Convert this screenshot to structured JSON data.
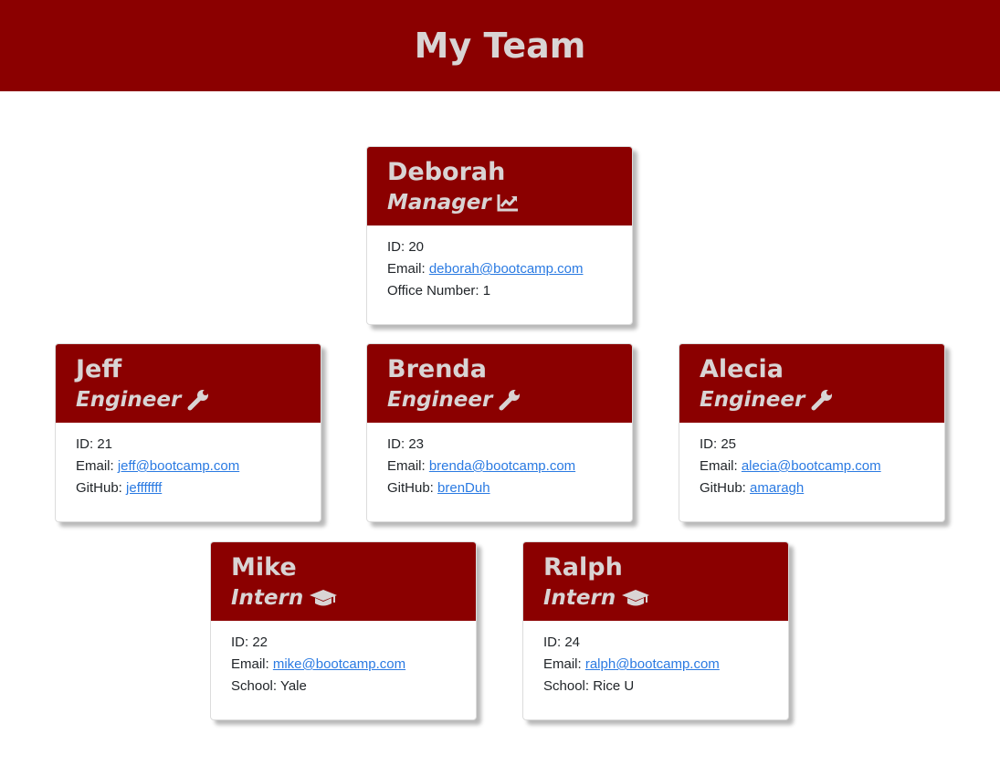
{
  "header": {
    "title": "My Team"
  },
  "labels": {
    "id": "ID: ",
    "email": "Email: ",
    "office": "Office Number: ",
    "github": "GitHub: ",
    "school": "School: "
  },
  "manager": {
    "name": "Deborah",
    "role": "Manager",
    "icon": "chart-line-icon",
    "id": "20",
    "email": "deborah@bootcamp.com",
    "office": "1"
  },
  "engineers": [
    {
      "name": "Jeff",
      "role": "Engineer",
      "icon": "wrench-icon",
      "id": "21",
      "email": "jeff@bootcamp.com",
      "github": "jefffffff"
    },
    {
      "name": "Brenda",
      "role": "Engineer",
      "icon": "wrench-icon",
      "id": "23",
      "email": "brenda@bootcamp.com",
      "github": "brenDuh"
    },
    {
      "name": "Alecia",
      "role": "Engineer",
      "icon": "wrench-icon",
      "id": "25",
      "email": "alecia@bootcamp.com",
      "github": "amaragh"
    }
  ],
  "interns": [
    {
      "name": "Mike",
      "role": "Intern",
      "icon": "graduation-cap-icon",
      "id": "22",
      "email": "mike@bootcamp.com",
      "school": "Yale"
    },
    {
      "name": "Ralph",
      "role": "Intern",
      "icon": "graduation-cap-icon",
      "id": "24",
      "email": "ralph@bootcamp.com",
      "school": "Rice U"
    }
  ],
  "colors": {
    "header_bg": "#8b0000",
    "header_text": "#d9d4d4",
    "link": "#2a7ae2"
  }
}
